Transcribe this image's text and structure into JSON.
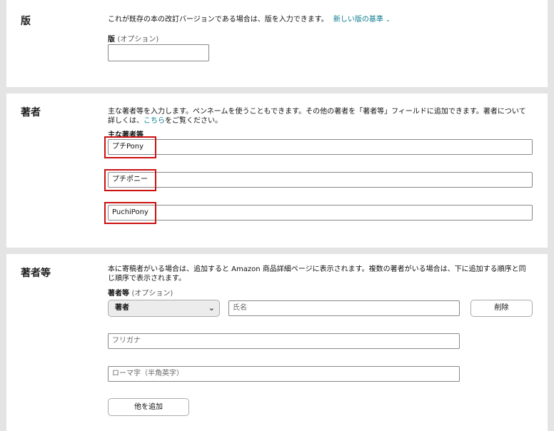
{
  "edition": {
    "heading": "版",
    "description": "これが既存の本の改訂バージョンである場合は、版を入力できます。",
    "link": "新しい版の基準",
    "link_icon": "chevron-down-icon",
    "field_label": "版",
    "field_optional": "(オプション)",
    "value": ""
  },
  "author": {
    "heading": "著者",
    "description_line1": "主な著者等を入力します。ペンネームを使うこともできます。その他の著者を「著者等」フィールドに追加できます。著者について",
    "description_line2_pre": "詳しくは、",
    "description_link": "こちら",
    "description_line2_post": "をご覧ください。",
    "field_label": "主な著者等",
    "name_value": "プチPony",
    "furigana_value": "プチポニー",
    "romaji_value": "PuchiPony"
  },
  "contributors": {
    "heading": "著者等",
    "description_line1": "本に寄稿者がいる場合は、追加すると Amazon 商品詳細ページに表示されます。複数の著者がいる場合は、下に追加する順序と同",
    "description_line2": "じ順序で表示されます。",
    "field_label": "著者等",
    "field_optional": "(オプション)",
    "role_selected": "著者",
    "role_icon": "chevron-down-icon",
    "name_placeholder": "氏名",
    "delete_label": "削除",
    "furigana_placeholder": "フリガナ",
    "romaji_placeholder": "ローマ字（半角英字）",
    "add_label": "他を追加"
  }
}
